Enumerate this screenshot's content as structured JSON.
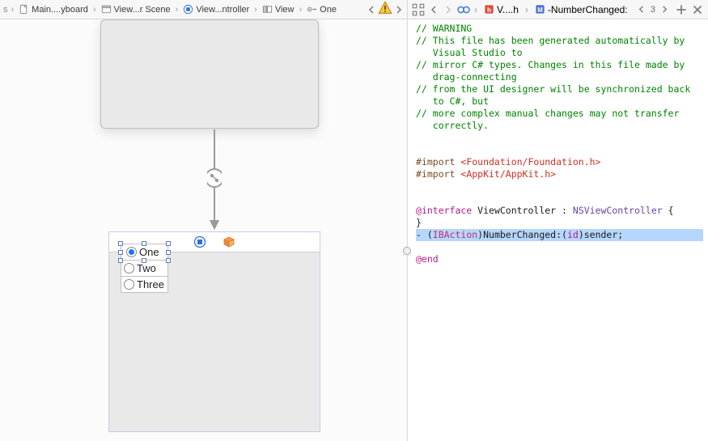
{
  "left": {
    "crumbs": [
      {
        "icon": "doc",
        "label": "Main....yboard"
      },
      {
        "icon": "scene",
        "label": "View...r Scene"
      },
      {
        "icon": "controller",
        "label": "View...ntroller"
      },
      {
        "icon": "view",
        "label": "View"
      },
      {
        "icon": "radio",
        "label": "One"
      }
    ],
    "warning_icon": "⚠︎",
    "radios": [
      "One",
      "Two",
      "Three"
    ],
    "selected_radio_index": 0
  },
  "right": {
    "crumbs": [
      {
        "icon": "h-red",
        "label": "V....h"
      },
      {
        "icon": "method",
        "label": "-NumberChanged:"
      }
    ],
    "counter": "3",
    "code": {
      "comments": [
        "// WARNING",
        "// This file has been generated automatically by Visual Studio to",
        "// mirror C# types. Changes in this file made by drag-connecting",
        "// from the UI designer will be synchronized back to C#, but",
        "// more complex manual changes may not transfer correctly."
      ],
      "import1_kw": "#import ",
      "import1_v": "<Foundation/Foundation.h>",
      "import2_kw": "#import ",
      "import2_v": "<AppKit/AppKit.h>",
      "interface_kw": "@interface ",
      "interface_name": "ViewController",
      "interface_colon": " : ",
      "interface_base": "NSViewController",
      "interface_brace": " {",
      "close_brace": "}",
      "action_dash": "- (",
      "action_ib": "IBAction",
      "action_mid": ")NumberChanged:(",
      "action_id": "id",
      "action_end": ")sender;",
      "end": "@end"
    }
  }
}
